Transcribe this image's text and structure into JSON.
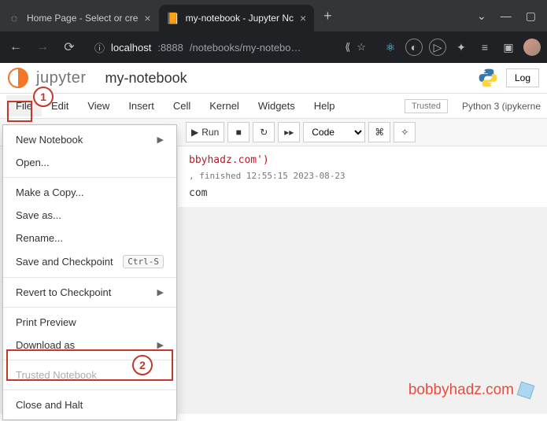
{
  "browser": {
    "tabs": [
      {
        "title": "Home Page - Select or cre",
        "favicon": "◌"
      },
      {
        "title": "my-notebook - Jupyter Nc",
        "favicon": "📓"
      }
    ],
    "url_host": "localhost",
    "url_port": ":8888",
    "url_path": "/notebooks/my-notebo…"
  },
  "header": {
    "logo_title": "jupyter",
    "notebook_name": "my-notebook",
    "login_label": "Log"
  },
  "menubar": {
    "items": [
      "File",
      "Edit",
      "View",
      "Insert",
      "Cell",
      "Kernel",
      "Widgets",
      "Help"
    ],
    "trusted_label": "Trusted",
    "kernel_label": "Python 3 (ipykerne"
  },
  "toolbar": {
    "run_label": "Run",
    "cell_type": "Code"
  },
  "dropdown": {
    "new_notebook": "New Notebook",
    "open": "Open...",
    "make_copy": "Make a Copy...",
    "save_as": "Save as...",
    "rename": "Rename...",
    "save_checkpoint": "Save and Checkpoint",
    "save_kbd": "Ctrl-S",
    "revert": "Revert to Checkpoint",
    "print_preview": "Print Preview",
    "download_as": "Download as",
    "trusted_notebook": "Trusted Notebook",
    "close_halt": "Close and Halt"
  },
  "annotations": {
    "one": "1",
    "two": "2"
  },
  "cell": {
    "code_fragment": "bbyhadz.com')",
    "finished": ", finished 12:55:15 2023-08-23",
    "output": "com"
  },
  "watermark": "bobbyhadz.com"
}
